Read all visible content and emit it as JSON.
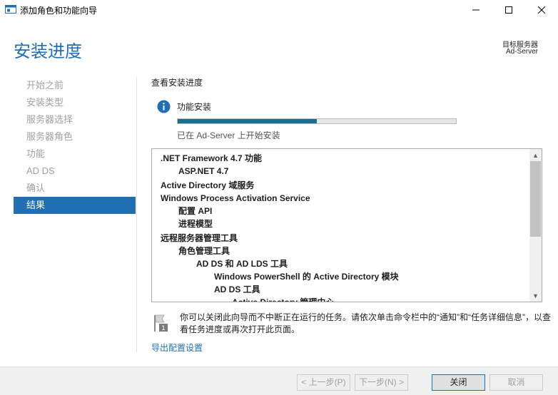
{
  "window": {
    "title": "添加角色和功能向导"
  },
  "header": {
    "page_title": "安装进度",
    "target_label": "目标服务器",
    "target_value": "Ad-Server"
  },
  "sidebar": {
    "items": [
      {
        "label": "开始之前",
        "active": false
      },
      {
        "label": "安装类型",
        "active": false
      },
      {
        "label": "服务器选择",
        "active": false
      },
      {
        "label": "服务器角色",
        "active": false
      },
      {
        "label": "功能",
        "active": false
      },
      {
        "label": "AD DS",
        "active": false
      },
      {
        "label": "确认",
        "active": false
      },
      {
        "label": "结果",
        "active": true
      }
    ]
  },
  "main": {
    "section_heading": "查看安装进度",
    "feature_label": "功能安装",
    "progress_percent": 50,
    "status_text": "已在 Ad-Server 上开始安装",
    "results": [
      {
        "text": ".NET Framework 4.7 功能",
        "level": 0
      },
      {
        "text": "ASP.NET 4.7",
        "level": 1
      },
      {
        "text": "Active Directory 域服务",
        "level": 0,
        "gap": true
      },
      {
        "text": "Windows Process Activation Service",
        "level": 0
      },
      {
        "text": "配置 API",
        "level": 1
      },
      {
        "text": "进程模型",
        "level": 1
      },
      {
        "text": "远程服务器管理工具",
        "level": 0,
        "gap": true
      },
      {
        "text": "角色管理工具",
        "level": 1
      },
      {
        "text": "AD DS 和 AD LDS 工具",
        "level": 2
      },
      {
        "text": "Windows PowerShell 的 Active Directory 模块",
        "level": 3
      },
      {
        "text": "AD DS 工具",
        "level": 3
      },
      {
        "text": "Active Directory 管理中心",
        "level": 4
      }
    ],
    "notice_text": "你可以关闭此向导而不中断正在运行的任务。请依次单击命令栏中的“通知”和“任务详细信息”，以查看任务进度或再次打开此页面。",
    "export_link": "导出配置设置"
  },
  "footer": {
    "prev_label": "< 上一步(P)",
    "next_label": "下一步(N) >",
    "install_label": "关闭",
    "cancel_label": "取消"
  },
  "colors": {
    "accent": "#1f6fb2",
    "progress": "#1a6f8f"
  }
}
